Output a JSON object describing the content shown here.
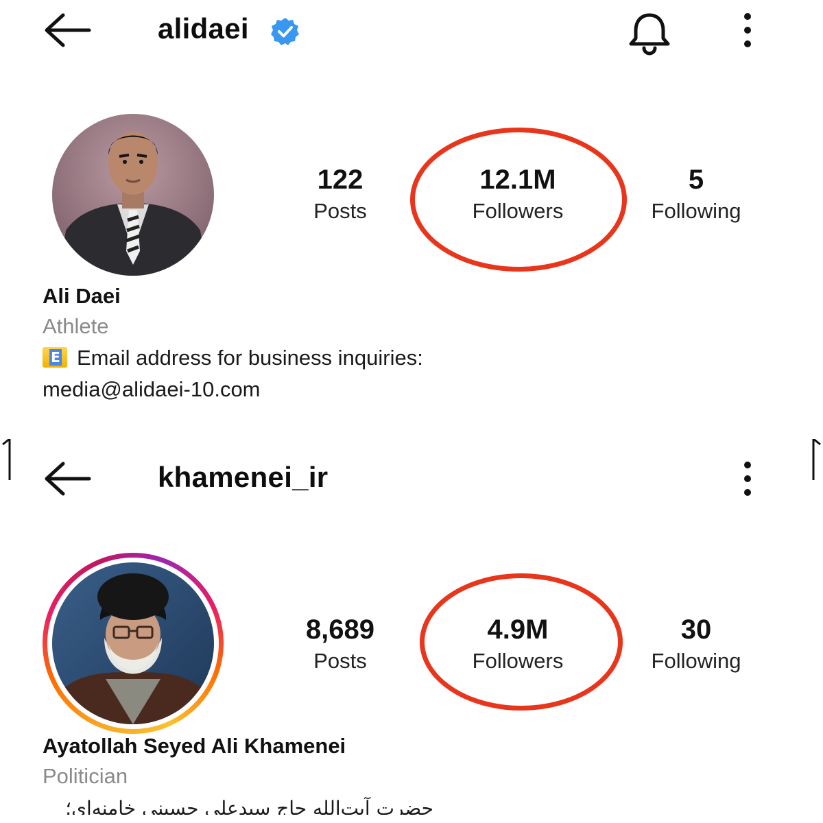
{
  "profiles": [
    {
      "username": "alidaei",
      "verified": true,
      "has_bell": true,
      "posts_count": "122",
      "posts_label": "Posts",
      "followers_count": "12.1M",
      "followers_label": "Followers",
      "following_count": "5",
      "following_label": "Following",
      "full_name": "Ali Daei",
      "category": "Athlete",
      "bio_badge": "E",
      "bio_line1": "Email address for business inquiries:",
      "bio_line2": "media@alidaei-10.com"
    },
    {
      "username": "khamenei_ir",
      "verified": false,
      "has_bell": false,
      "has_story_ring": true,
      "posts_count": "8,689",
      "posts_label": "Posts",
      "followers_count": "4.9M",
      "followers_label": "Followers",
      "following_count": "30",
      "following_label": "Following",
      "full_name": "Ayatollah Seyed Ali Khamenei",
      "category": "Politician",
      "bio_line1": "حضرت آیت‌الله حاج سیدعلی حسینی خامنه‌ای؛"
    }
  ],
  "icons": [
    "back-arrow-icon",
    "verified-badge-icon",
    "bell-icon",
    "more-options-icon",
    "email-e-badge-icon"
  ],
  "colors": {
    "highlight_ring": "#e8361c",
    "verified_blue": "#3897f0",
    "category_gray": "#8a8a8a",
    "story_ring_gradient": [
      "#f9a825",
      "#ff6f00",
      "#e91e63",
      "#9c27b0"
    ]
  }
}
